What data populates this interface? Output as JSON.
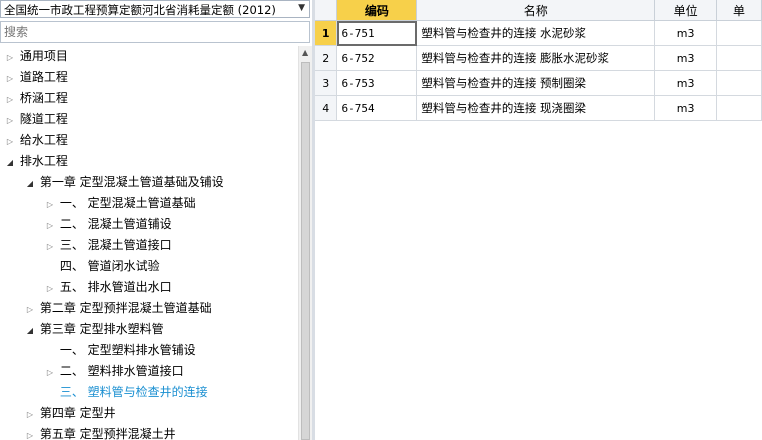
{
  "library": {
    "selected": "全国统一市政工程预算定额河北省消耗量定额 (2012)"
  },
  "search": {
    "placeholder": "搜索"
  },
  "tree": {
    "nodes": [
      {
        "label": "通用项目",
        "toggle": "▷"
      },
      {
        "label": "道路工程",
        "toggle": "▷"
      },
      {
        "label": "桥涵工程",
        "toggle": "▷"
      },
      {
        "label": "隧道工程",
        "toggle": "▷"
      },
      {
        "label": "给水工程",
        "toggle": "▷"
      },
      {
        "label": "排水工程",
        "toggle": "◢"
      },
      {
        "label": "第一章  定型混凝土管道基础及铺设",
        "toggle": "◢"
      },
      {
        "label": "一、  定型混凝土管道基础",
        "toggle": "▷"
      },
      {
        "label": "二、  混凝土管道铺设",
        "toggle": "▷"
      },
      {
        "label": "三、  混凝土管道接口",
        "toggle": "▷"
      },
      {
        "label": "四、  管道闭水试验",
        "toggle": ""
      },
      {
        "label": "五、  排水管道出水口",
        "toggle": "▷"
      },
      {
        "label": "第二章  定型预拌混凝土管道基础",
        "toggle": "▷"
      },
      {
        "label": "第三章  定型排水塑料管",
        "toggle": "◢"
      },
      {
        "label": "一、  定型塑料排水管铺设",
        "toggle": ""
      },
      {
        "label": "二、  塑料排水管道接口",
        "toggle": "▷"
      },
      {
        "label": "三、  塑料管与检查井的连接",
        "toggle": ""
      },
      {
        "label": "第四章  定型井",
        "toggle": "▷"
      },
      {
        "label": "第五章  定型预拌混凝土井",
        "toggle": "▷"
      }
    ]
  },
  "grid": {
    "headers": {
      "code": "编码",
      "name": "名称",
      "unit": "单位",
      "extra": "单"
    },
    "rows": [
      {
        "num": "1",
        "code": "6-751",
        "name": "塑料管与检查井的连接 水泥砂浆",
        "unit": "m3"
      },
      {
        "num": "2",
        "code": "6-752",
        "name": "塑料管与检查井的连接 膨胀水泥砂浆",
        "unit": "m3"
      },
      {
        "num": "3",
        "code": "6-753",
        "name": "塑料管与检查井的连接 预制圈梁",
        "unit": "m3"
      },
      {
        "num": "4",
        "code": "6-754",
        "name": "塑料管与检查井的连接 现浇圈梁",
        "unit": "m3"
      }
    ]
  },
  "icons": {
    "dropdown": "chevron-down-icon",
    "scroll_up": "arrow-up-icon"
  },
  "colors": {
    "accent": "#f7d04a",
    "selected_text": "#1a8fd1"
  }
}
